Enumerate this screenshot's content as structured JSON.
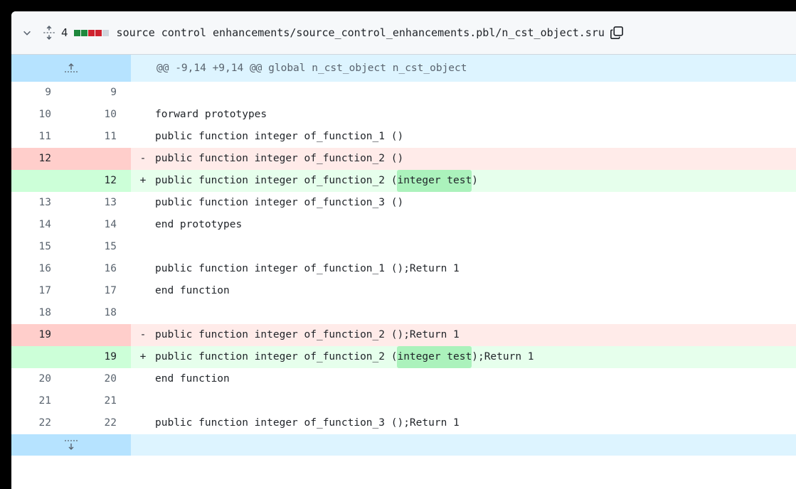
{
  "file": {
    "change_count": "4",
    "diffstat": [
      "#1f883d",
      "#1f883d",
      "#cf222e",
      "#cf222e",
      "#d0d7de"
    ],
    "path": "source control enhancements/source_control_enhancements.pbl/n_cst_object.sru",
    "icons": {
      "collapse": "chevron-down-icon",
      "expand_all": "unfold-icon",
      "copy": "copy-icon"
    }
  },
  "hunk": {
    "header": "@@ -9,14 +9,14 @@ global n_cst_object n_cst_object",
    "expand_up_icon": "expand-up-icon",
    "expand_down_icon": "expand-down-icon"
  },
  "lines": [
    {
      "type": "ctx",
      "old": "9",
      "new": "9",
      "marker": "",
      "code": ""
    },
    {
      "type": "ctx",
      "old": "10",
      "new": "10",
      "marker": "",
      "code": "forward prototypes"
    },
    {
      "type": "ctx",
      "old": "11",
      "new": "11",
      "marker": "",
      "code": "public function integer of_function_1 ()"
    },
    {
      "type": "del",
      "old": "12",
      "new": "",
      "marker": "-",
      "code": "public function integer of_function_2 ()"
    },
    {
      "type": "add",
      "old": "",
      "new": "12",
      "marker": "+",
      "code": "public function integer of_function_2 (",
      "hl": "integer test",
      "post": ")"
    },
    {
      "type": "ctx",
      "old": "13",
      "new": "13",
      "marker": "",
      "code": "public function integer of_function_3 ()"
    },
    {
      "type": "ctx",
      "old": "14",
      "new": "14",
      "marker": "",
      "code": "end prototypes"
    },
    {
      "type": "ctx",
      "old": "15",
      "new": "15",
      "marker": "",
      "code": ""
    },
    {
      "type": "ctx",
      "old": "16",
      "new": "16",
      "marker": "",
      "code": "public function integer of_function_1 ();Return 1"
    },
    {
      "type": "ctx",
      "old": "17",
      "new": "17",
      "marker": "",
      "code": "end function"
    },
    {
      "type": "ctx",
      "old": "18",
      "new": "18",
      "marker": "",
      "code": ""
    },
    {
      "type": "del",
      "old": "19",
      "new": "",
      "marker": "-",
      "code": "public function integer of_function_2 ();Return 1"
    },
    {
      "type": "add",
      "old": "",
      "new": "19",
      "marker": "+",
      "code": "public function integer of_function_2 (",
      "hl": "integer test",
      "post": ");Return 1"
    },
    {
      "type": "ctx",
      "old": "20",
      "new": "20",
      "marker": "",
      "code": "end function"
    },
    {
      "type": "ctx",
      "old": "21",
      "new": "21",
      "marker": "",
      "code": ""
    },
    {
      "type": "ctx",
      "old": "22",
      "new": "22",
      "marker": "",
      "code": "public function integer of_function_3 ();Return 1"
    }
  ]
}
